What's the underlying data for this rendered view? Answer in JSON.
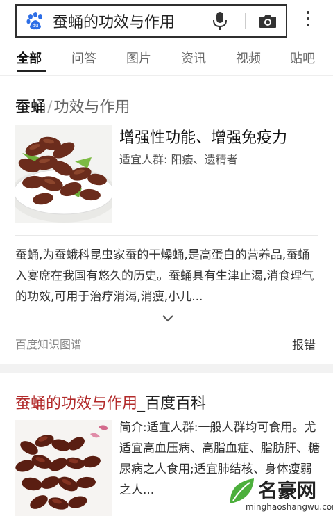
{
  "search": {
    "query": "蚕蛹的功效与作用"
  },
  "tabs": [
    {
      "label": "全部",
      "active": true
    },
    {
      "label": "问答"
    },
    {
      "label": "图片"
    },
    {
      "label": "资讯"
    },
    {
      "label": "视频"
    },
    {
      "label": "贴吧"
    }
  ],
  "knowledge_card": {
    "title_main": "蚕蛹",
    "title_sep": "/",
    "title_sub": "功效与作用",
    "headline": "增强性功能、增强免疫力",
    "meta_label": "适宜人群:",
    "meta_value": "阳痿、遗精者",
    "description": "蚕蛹,为蚕蛾科昆虫家蚕的干燥蛹,是高蛋白的营养品,蚕蛹入宴席在我国有悠久的历史。蚕蛹具有生津止渴,消食理气的功效,可用于治疗消渴,消瘦,小儿...",
    "source": "百度知识图谱",
    "report": "报错"
  },
  "result_card": {
    "title_keyword": "蚕蛹的功效与作用",
    "title_rest": "_百度百科",
    "description": "简介:适宜人群:一般人群均可食用。尤适宜高血压病、高脂血症、脂肪肝、糖尿病之人食用;适宜肺结核、身体瘦弱之人..."
  },
  "watermark": {
    "name": "名豪网",
    "url": "minghaoshangwu.com"
  },
  "colors": {
    "keyword_red": "#b22a2a",
    "baidu_blue": "#2d6ee6"
  }
}
